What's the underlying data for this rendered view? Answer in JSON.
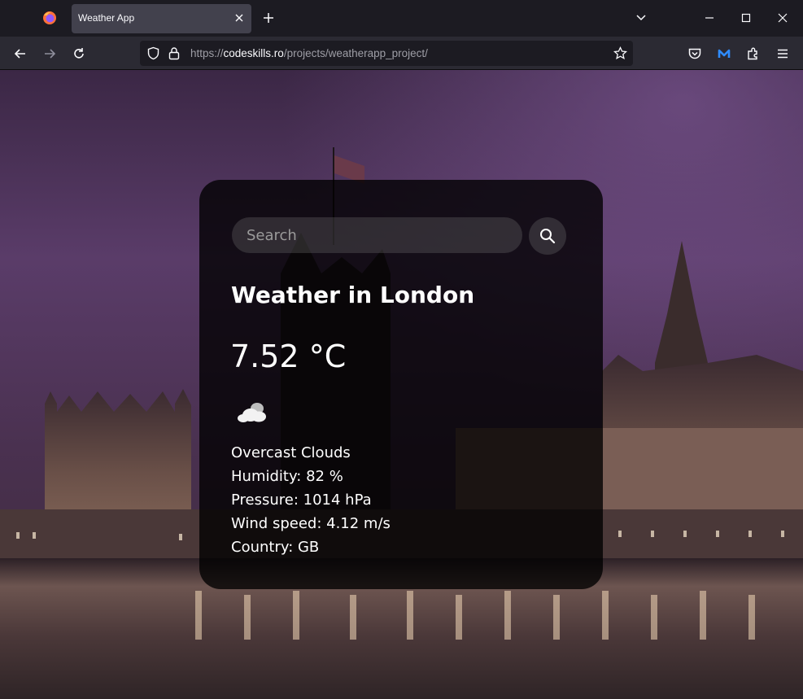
{
  "browser": {
    "tab_title": "Weather App",
    "url_prefix": "https://",
    "url_host": "codeskills.ro",
    "url_path": "/projects/weatherapp_project/"
  },
  "icons": {
    "browser_logo": "firefox-icon",
    "tab_close": "close-icon",
    "new_tab": "plus-icon",
    "tab_list": "chevron-down-icon",
    "minimize": "minimize-icon",
    "maximize": "maximize-icon",
    "close_window": "close-icon",
    "back": "arrow-left-icon",
    "forward": "arrow-right-icon",
    "reload": "reload-icon",
    "tracking": "shield-icon",
    "lock": "lock-icon",
    "bookmark": "star-icon",
    "pocket": "pocket-icon",
    "extension_m": "extension-m-icon",
    "extensions": "puzzle-icon",
    "menu": "hamburger-icon",
    "search": "search-icon",
    "weather": "cloud-icon"
  },
  "weather": {
    "search_placeholder": "Search",
    "city_title": "Weather in London",
    "temperature": "7.52 °C",
    "description": "Overcast Clouds",
    "humidity": "Humidity: 82 %",
    "pressure": "Pressure: 1014 hPa",
    "wind": "Wind speed: 4.12 m/s",
    "country": "Country: GB"
  },
  "colors": {
    "chrome_dark": "#1c1b22",
    "toolbar": "#2b2a33",
    "tab_active": "#42414d",
    "card_bg": "#000000",
    "text": "#ffffff"
  }
}
